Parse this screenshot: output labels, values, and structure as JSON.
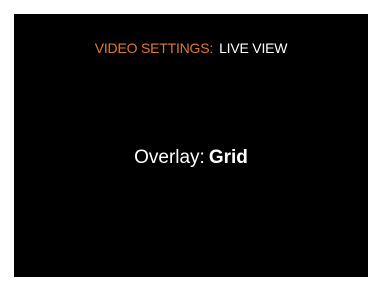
{
  "header": {
    "section_label": "VIDEO SETTINGS:",
    "page_label": "LIVE VIEW"
  },
  "setting": {
    "label": "Overlay:",
    "value": "Grid"
  },
  "colors": {
    "background": "#000000",
    "accent": "#e07a2c",
    "text": "#ffffff"
  }
}
